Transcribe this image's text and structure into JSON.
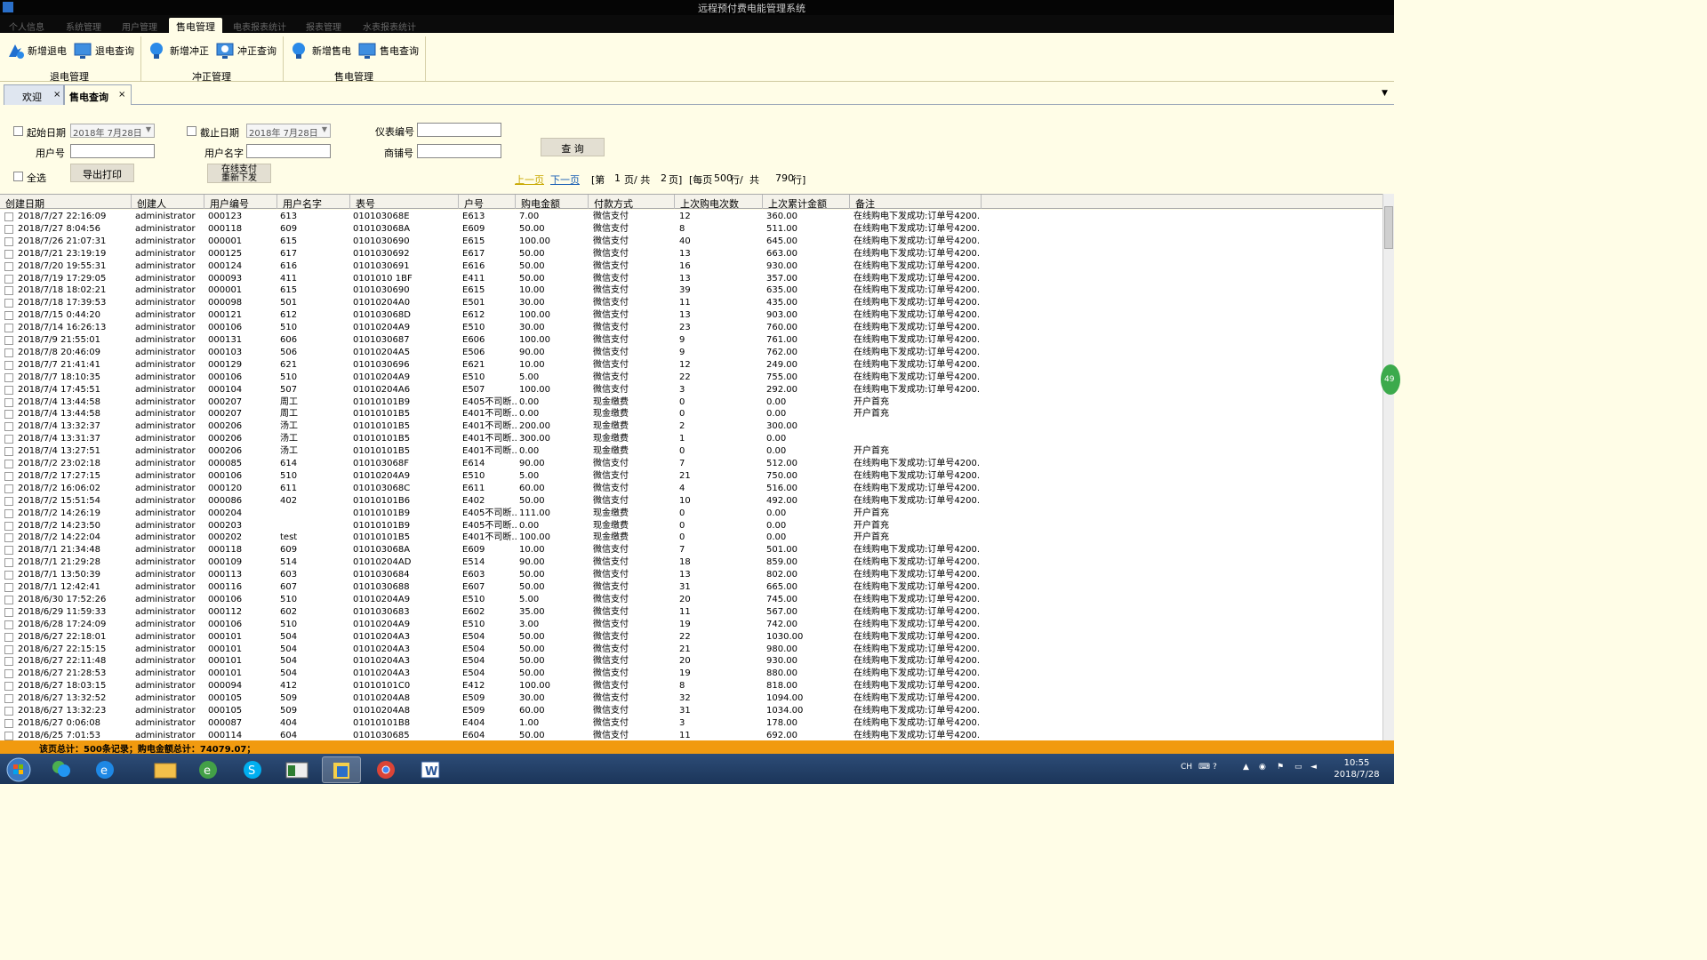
{
  "window": {
    "title": "远程预付费电能管理系统"
  },
  "menu": {
    "tabs": [
      "个人信息",
      "系统管理",
      "用户管理",
      "售电管理",
      "电表报表统计",
      "报表管理",
      "水表报表统计"
    ],
    "active_index": 3
  },
  "ribbon": {
    "groups": [
      {
        "label": "退电管理",
        "buttons": [
          "新增退电",
          "退电查询"
        ]
      },
      {
        "label": "冲正管理",
        "buttons": [
          "新增冲正",
          "冲正查询"
        ]
      },
      {
        "label": "售电管理",
        "buttons": [
          "新增售电",
          "售电查询"
        ]
      }
    ]
  },
  "doc_tabs": [
    {
      "label": "欢迎",
      "close": "×"
    },
    {
      "label": "售电查询",
      "close": "×"
    }
  ],
  "doc_tabs_menu": "▼",
  "filter": {
    "start_date_label": "起始日期",
    "start_date_value": "2018年  7月28日",
    "end_date_label": "截止日期",
    "end_date_value": "2018年  7月28日",
    "meter_no_label": "仪表编号",
    "user_no_label": "用户号",
    "user_name_label": "用户名字",
    "shop_no_label": "商铺号",
    "select_all_label": "全选",
    "query_button": "查 询",
    "export_button": "导出打印",
    "resend_button_line1": "在线支付",
    "resend_button_line2": "重新下发"
  },
  "pagination": {
    "prev": "上一页",
    "next": "下一页",
    "text_page_prefix": "[第",
    "current_page": "1",
    "text_page_mid": "页/ 共",
    "total_pages": "2",
    "text_page_suffix": "页]",
    "text_per_page_prefix": "[每页",
    "per_page": "500",
    "text_per_page_mid": "行/",
    "text_total_prefix": "共",
    "total_rows": "790",
    "text_total_suffix": "行]"
  },
  "columns": [
    "创建日期",
    "创建人",
    "用户编号",
    "用户名字",
    "表号",
    "户号",
    "购电金额",
    "付款方式",
    "上次购电次数",
    "上次累计金额",
    "备注"
  ],
  "rows": [
    [
      "2018/7/27 22:16:09",
      "administrator",
      "000123",
      "613",
      "010103068E",
      "E613",
      "7.00",
      "微信支付",
      "12",
      "360.00",
      "在线购电下发成功:订单号4200..."
    ],
    [
      "2018/7/27 8:04:56",
      "administrator",
      "000118",
      "609",
      "010103068A",
      "E609",
      "50.00",
      "微信支付",
      "8",
      "511.00",
      "在线购电下发成功:订单号4200..."
    ],
    [
      "2018/7/26 21:07:31",
      "administrator",
      "000001",
      "615",
      "0101030690",
      "E615",
      "100.00",
      "微信支付",
      "40",
      "645.00",
      "在线购电下发成功:订单号4200..."
    ],
    [
      "2018/7/21 23:19:19",
      "administrator",
      "000125",
      "617",
      "0101030692",
      "E617",
      "50.00",
      "微信支付",
      "13",
      "663.00",
      "在线购电下发成功:订单号4200..."
    ],
    [
      "2018/7/20 19:55:31",
      "administrator",
      "000124",
      "616",
      "0101030691",
      "E616",
      "50.00",
      "微信支付",
      "16",
      "930.00",
      "在线购电下发成功:订单号4200..."
    ],
    [
      "2018/7/19 17:29:05",
      "administrator",
      "000093",
      "411",
      "0101010 1BF",
      "E411",
      "50.00",
      "微信支付",
      "13",
      "357.00",
      "在线购电下发成功:订单号4200..."
    ],
    [
      "2018/7/18 18:02:21",
      "administrator",
      "000001",
      "615",
      "0101030690",
      "E615",
      "10.00",
      "微信支付",
      "39",
      "635.00",
      "在线购电下发成功:订单号4200..."
    ],
    [
      "2018/7/18 17:39:53",
      "administrator",
      "000098",
      "501",
      "01010204A0",
      "E501",
      "30.00",
      "微信支付",
      "11",
      "435.00",
      "在线购电下发成功:订单号4200..."
    ],
    [
      "2018/7/15 0:44:20",
      "administrator",
      "000121",
      "612",
      "010103068D",
      "E612",
      "100.00",
      "微信支付",
      "13",
      "903.00",
      "在线购电下发成功:订单号4200..."
    ],
    [
      "2018/7/14 16:26:13",
      "administrator",
      "000106",
      "510",
      "01010204A9",
      "E510",
      "30.00",
      "微信支付",
      "23",
      "760.00",
      "在线购电下发成功:订单号4200..."
    ],
    [
      "2018/7/9 21:55:01",
      "administrator",
      "000131",
      "606",
      "0101030687",
      "E606",
      "100.00",
      "微信支付",
      "9",
      "761.00",
      "在线购电下发成功:订单号4200..."
    ],
    [
      "2018/7/8 20:46:09",
      "administrator",
      "000103",
      "506",
      "01010204A5",
      "E506",
      "90.00",
      "微信支付",
      "9",
      "762.00",
      "在线购电下发成功:订单号4200..."
    ],
    [
      "2018/7/7 21:41:41",
      "administrator",
      "000129",
      "621",
      "0101030696",
      "E621",
      "10.00",
      "微信支付",
      "12",
      "249.00",
      "在线购电下发成功:订单号4200..."
    ],
    [
      "2018/7/7 18:10:35",
      "administrator",
      "000106",
      "510",
      "01010204A9",
      "E510",
      "5.00",
      "微信支付",
      "22",
      "755.00",
      "在线购电下发成功:订单号4200..."
    ],
    [
      "2018/7/4 17:45:51",
      "administrator",
      "000104",
      "507",
      "01010204A6",
      "E507",
      "100.00",
      "微信支付",
      "3",
      "292.00",
      "在线购电下发成功:订单号4200..."
    ],
    [
      "2018/7/4 13:44:58",
      "administrator",
      "000207",
      "周工",
      "01010101B9",
      "E405不司断...",
      "0.00",
      "现金缴费",
      "0",
      "0.00",
      "开户首充"
    ],
    [
      "2018/7/4 13:44:58",
      "administrator",
      "000207",
      "周工",
      "01010101B5",
      "E401不司断...",
      "0.00",
      "现金缴费",
      "0",
      "0.00",
      "开户首充"
    ],
    [
      "2018/7/4 13:32:37",
      "administrator",
      "000206",
      "汤工",
      "01010101B5",
      "E401不司断...",
      "200.00",
      "现金缴费",
      "2",
      "300.00",
      ""
    ],
    [
      "2018/7/4 13:31:37",
      "administrator",
      "000206",
      "汤工",
      "01010101B5",
      "E401不司断...",
      "300.00",
      "现金缴费",
      "1",
      "0.00",
      ""
    ],
    [
      "2018/7/4 13:27:51",
      "administrator",
      "000206",
      "汤工",
      "01010101B5",
      "E401不司断...",
      "0.00",
      "现金缴费",
      "0",
      "0.00",
      "开户首充"
    ],
    [
      "2018/7/2 23:02:18",
      "administrator",
      "000085",
      "614",
      "010103068F",
      "E614",
      "90.00",
      "微信支付",
      "7",
      "512.00",
      "在线购电下发成功:订单号4200..."
    ],
    [
      "2018/7/2 17:27:15",
      "administrator",
      "000106",
      "510",
      "01010204A9",
      "E510",
      "5.00",
      "微信支付",
      "21",
      "750.00",
      "在线购电下发成功:订单号4200..."
    ],
    [
      "2018/7/2 16:06:02",
      "administrator",
      "000120",
      "611",
      "010103068C",
      "E611",
      "60.00",
      "微信支付",
      "4",
      "516.00",
      "在线购电下发成功:订单号4200..."
    ],
    [
      "2018/7/2 15:51:54",
      "administrator",
      "000086",
      "402",
      "01010101B6",
      "E402",
      "50.00",
      "微信支付",
      "10",
      "492.00",
      "在线购电下发成功:订单号4200..."
    ],
    [
      "2018/7/2 14:26:19",
      "administrator",
      "000204",
      "",
      "01010101B9",
      "E405不司断...",
      "111.00",
      "现金缴费",
      "0",
      "0.00",
      "开户首充"
    ],
    [
      "2018/7/2 14:23:50",
      "administrator",
      "000203",
      "",
      "01010101B9",
      "E405不司断...",
      "0.00",
      "现金缴费",
      "0",
      "0.00",
      "开户首充"
    ],
    [
      "2018/7/2 14:22:04",
      "administrator",
      "000202",
      "test",
      "01010101B5",
      "E401不司断...",
      "100.00",
      "现金缴费",
      "0",
      "0.00",
      "开户首充"
    ],
    [
      "2018/7/1 21:34:48",
      "administrator",
      "000118",
      "609",
      "010103068A",
      "E609",
      "10.00",
      "微信支付",
      "7",
      "501.00",
      "在线购电下发成功:订单号4200..."
    ],
    [
      "2018/7/1 21:29:28",
      "administrator",
      "000109",
      "514",
      "01010204AD",
      "E514",
      "90.00",
      "微信支付",
      "18",
      "859.00",
      "在线购电下发成功:订单号4200..."
    ],
    [
      "2018/7/1 13:50:39",
      "administrator",
      "000113",
      "603",
      "0101030684",
      "E603",
      "50.00",
      "微信支付",
      "13",
      "802.00",
      "在线购电下发成功:订单号4200..."
    ],
    [
      "2018/7/1 12:42:41",
      "administrator",
      "000116",
      "607",
      "0101030688",
      "E607",
      "50.00",
      "微信支付",
      "31",
      "665.00",
      "在线购电下发成功:订单号4200..."
    ],
    [
      "2018/6/30 17:52:26",
      "administrator",
      "000106",
      "510",
      "01010204A9",
      "E510",
      "5.00",
      "微信支付",
      "20",
      "745.00",
      "在线购电下发成功:订单号4200..."
    ],
    [
      "2018/6/29 11:59:33",
      "administrator",
      "000112",
      "602",
      "0101030683",
      "E602",
      "35.00",
      "微信支付",
      "11",
      "567.00",
      "在线购电下发成功:订单号4200..."
    ],
    [
      "2018/6/28 17:24:09",
      "administrator",
      "000106",
      "510",
      "01010204A9",
      "E510",
      "3.00",
      "微信支付",
      "19",
      "742.00",
      "在线购电下发成功:订单号4200..."
    ],
    [
      "2018/6/27 22:18:01",
      "administrator",
      "000101",
      "504",
      "01010204A3",
      "E504",
      "50.00",
      "微信支付",
      "22",
      "1030.00",
      "在线购电下发成功:订单号4200..."
    ],
    [
      "2018/6/27 22:15:15",
      "administrator",
      "000101",
      "504",
      "01010204A3",
      "E504",
      "50.00",
      "微信支付",
      "21",
      "980.00",
      "在线购电下发成功:订单号4200..."
    ],
    [
      "2018/6/27 22:11:48",
      "administrator",
      "000101",
      "504",
      "01010204A3",
      "E504",
      "50.00",
      "微信支付",
      "20",
      "930.00",
      "在线购电下发成功:订单号4200..."
    ],
    [
      "2018/6/27 21:28:53",
      "administrator",
      "000101",
      "504",
      "01010204A3",
      "E504",
      "50.00",
      "微信支付",
      "19",
      "880.00",
      "在线购电下发成功:订单号4200..."
    ],
    [
      "2018/6/27 18:03:15",
      "administrator",
      "000094",
      "412",
      "01010101C0",
      "E412",
      "100.00",
      "微信支付",
      "8",
      "818.00",
      "在线购电下发成功:订单号4200..."
    ],
    [
      "2018/6/27 13:32:52",
      "administrator",
      "000105",
      "509",
      "01010204A8",
      "E509",
      "30.00",
      "微信支付",
      "32",
      "1094.00",
      "在线购电下发成功:订单号4200..."
    ],
    [
      "2018/6/27 13:32:23",
      "administrator",
      "000105",
      "509",
      "01010204A8",
      "E509",
      "60.00",
      "微信支付",
      "31",
      "1034.00",
      "在线购电下发成功:订单号4200..."
    ],
    [
      "2018/6/27 0:06:08",
      "administrator",
      "000087",
      "404",
      "01010101B8",
      "E404",
      "1.00",
      "微信支付",
      "3",
      "178.00",
      "在线购电下发成功:订单号4200..."
    ],
    [
      "2018/6/25 7:01:53",
      "administrator",
      "000114",
      "604",
      "0101030685",
      "E604",
      "50.00",
      "微信支付",
      "11",
      "692.00",
      "在线购电下发成功:订单号4200..."
    ]
  ],
  "status_bar": "该页总计：500条记录；购电金额总计：74079.07；",
  "side_badge": "49",
  "taskbar": {
    "lang": "CH",
    "time": "10:55",
    "date": "2018/7/28"
  },
  "colors": {
    "app_bg": "#fffde7",
    "status_bar": "#f19a0f",
    "taskbar": "#1f3c64",
    "link": "#1a5fb4",
    "prev_disabled": "#c8a800"
  }
}
